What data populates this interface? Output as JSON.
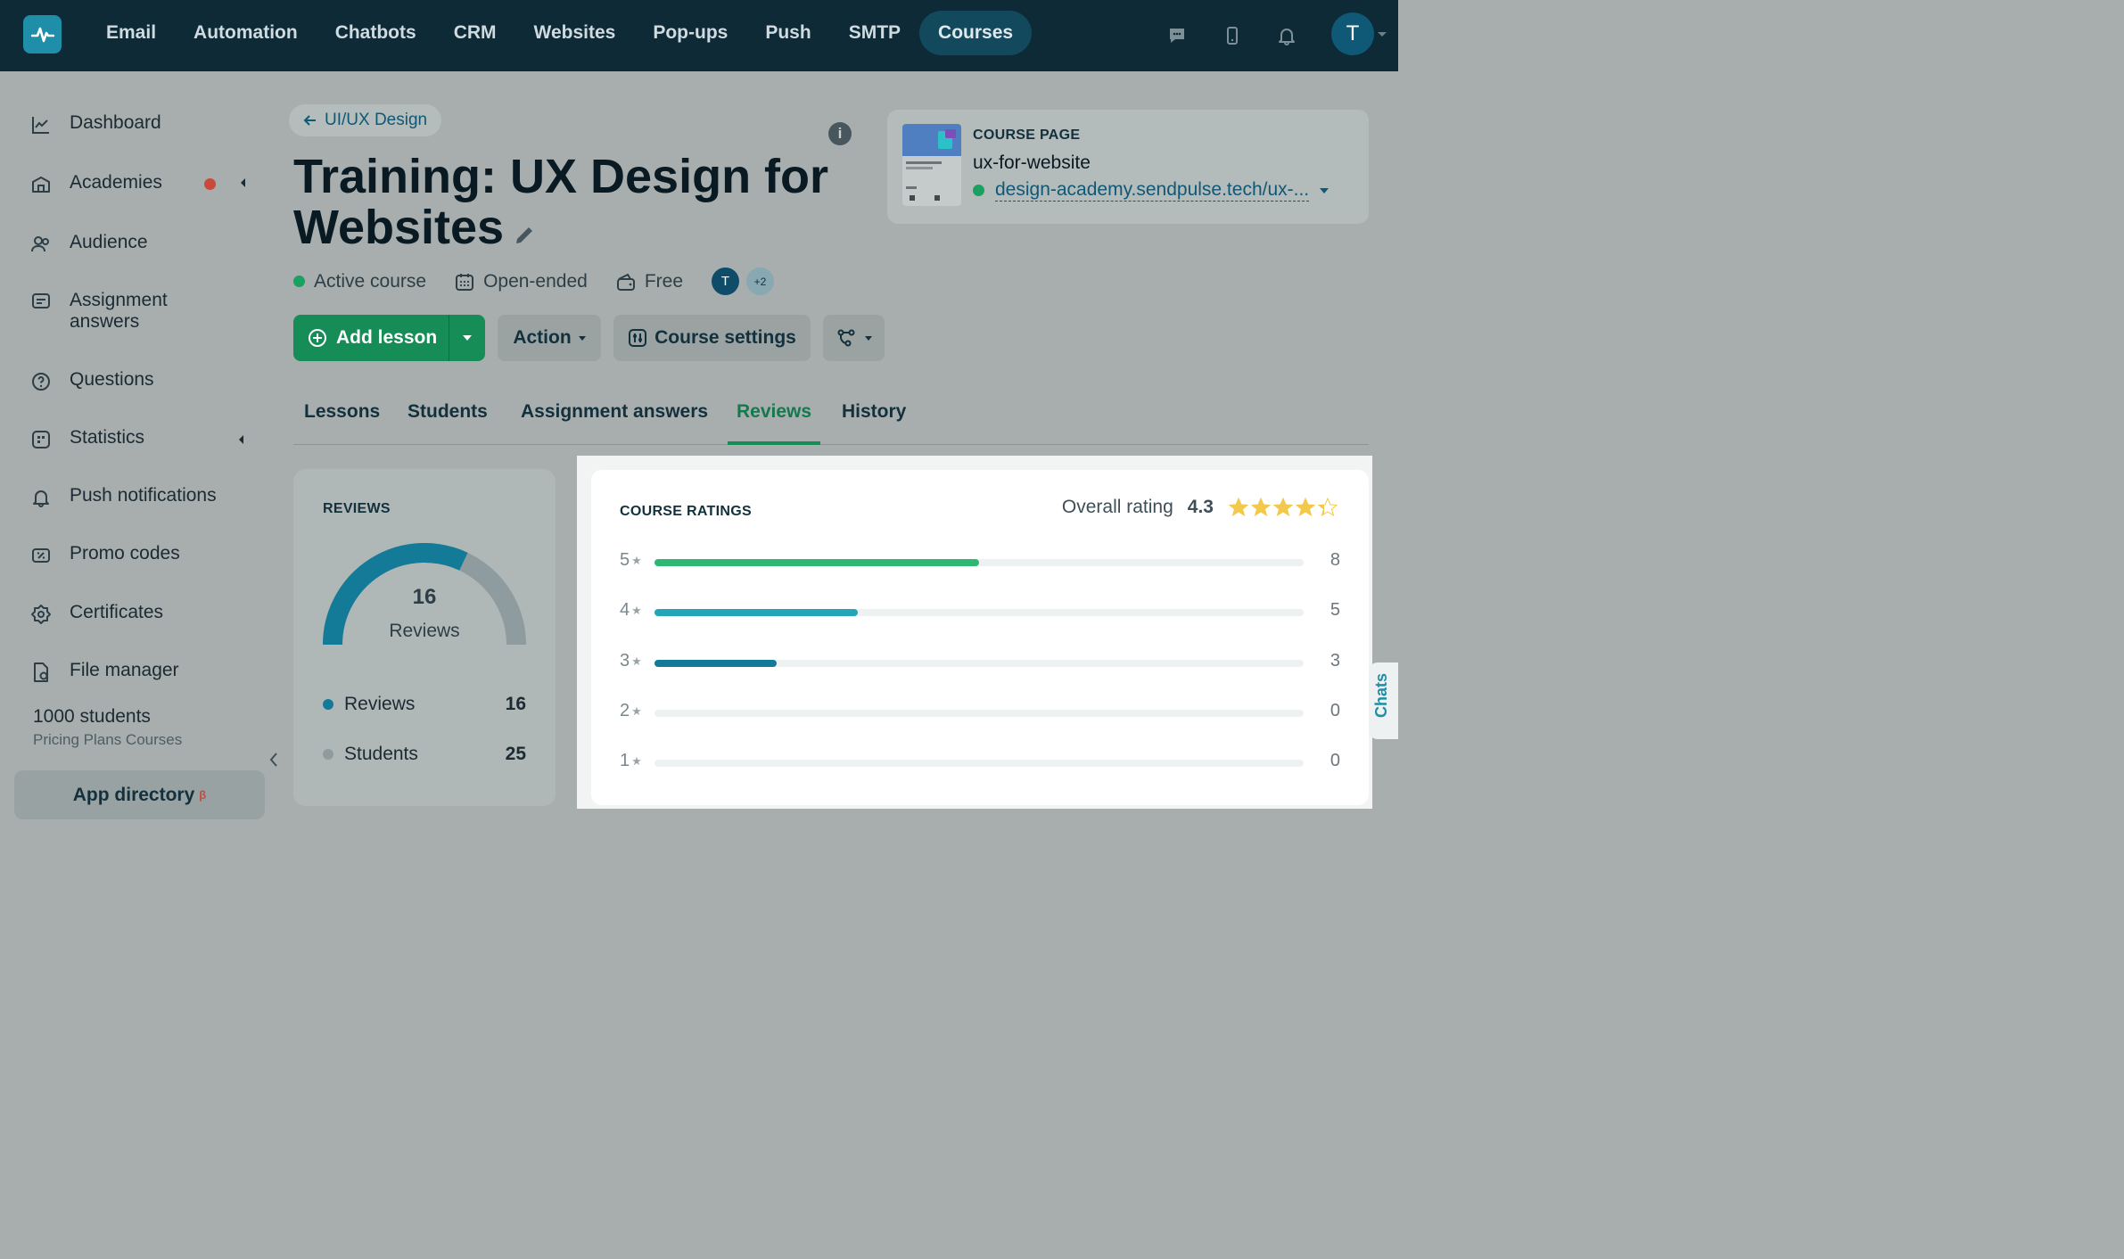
{
  "topnav": {
    "items": [
      "Email",
      "Automation",
      "Chatbots",
      "CRM",
      "Websites",
      "Pop-ups",
      "Push",
      "SMTP",
      "Courses"
    ],
    "active": "Courses",
    "avatar_initial": "T"
  },
  "sidebar": {
    "items": [
      {
        "label": "Dashboard",
        "icon": "chart-line-icon"
      },
      {
        "label": "Academies",
        "icon": "academy-icon"
      },
      {
        "label": "Audience",
        "icon": "users-icon"
      },
      {
        "label": "Assignment answers",
        "icon": "assignment-icon"
      },
      {
        "label": "Questions",
        "icon": "question-icon"
      },
      {
        "label": "Statistics",
        "icon": "statistics-icon"
      },
      {
        "label": "Push notifications",
        "icon": "bell-icon"
      },
      {
        "label": "Promo codes",
        "icon": "promo-icon"
      },
      {
        "label": "Certificates",
        "icon": "certificate-icon"
      },
      {
        "label": "File manager",
        "icon": "file-icon"
      }
    ],
    "plan_count": "1000 students",
    "plan_name": "Pricing Plans Courses",
    "app_directory": "App directory",
    "beta": "β"
  },
  "course": {
    "breadcrumb": "UI/UX Design",
    "title": "Training: UX Design for Websites",
    "status": "Active course",
    "duration": "Open-ended",
    "price": "Free",
    "author_initial": "T",
    "more_authors": "+2"
  },
  "course_page": {
    "label": "COURSE PAGE",
    "slug": "ux-for-website",
    "url": "design-academy.sendpulse.tech/ux-..."
  },
  "actions": {
    "add_lesson": "Add lesson",
    "action": "Action",
    "course_settings": "Course settings"
  },
  "tabs": [
    "Lessons",
    "Students",
    "Assignment answers",
    "Reviews",
    "History"
  ],
  "active_tab": "Reviews",
  "reviews": {
    "title": "REVIEWS",
    "count": "16",
    "count_label": "Reviews",
    "legend": [
      {
        "label": "Reviews",
        "value": "16",
        "color": "#137b98"
      },
      {
        "label": "Students",
        "value": "25",
        "color": "#8e9b9f"
      }
    ],
    "reviews_num": 16,
    "students_num": 25
  },
  "ratings": {
    "title": "COURSE RATINGS",
    "overall_label": "Overall rating",
    "overall_value": "4.3",
    "overall_num": 4.3,
    "max": 16,
    "rows": [
      {
        "stars": "5",
        "count": "8",
        "value": 8,
        "color": "#2fb874"
      },
      {
        "stars": "4",
        "count": "5",
        "value": 5,
        "color": "#23a6b5"
      },
      {
        "stars": "3",
        "count": "3",
        "value": 3,
        "color": "#137b98"
      },
      {
        "stars": "2",
        "count": "0",
        "value": 0,
        "color": "#137b98"
      },
      {
        "stars": "1",
        "count": "0",
        "value": 0,
        "color": "#137b98"
      }
    ]
  },
  "chats_label": "Chats",
  "colors": {
    "topbar": "#0d2a36",
    "primary_green": "#168d57",
    "accent_teal": "#137b98",
    "star_yellow": "#f2c94c"
  }
}
